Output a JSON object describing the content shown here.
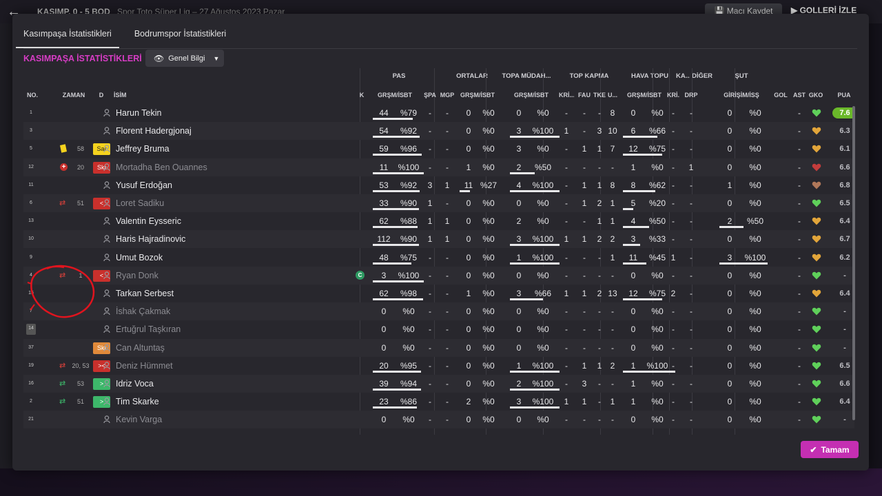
{
  "header": {
    "match_title": "KASIMP. 0 - 5 BOD",
    "match_sub": "Spor Toto Süper Lig – 27 Ağustos 2023 Pazar",
    "save_label": "Maçı Kaydet",
    "goals_label": "GOLLERİ İZLE"
  },
  "tabs": [
    {
      "label": "Kasımpaşa İstatistikleri",
      "active": true
    },
    {
      "label": "Bodrumspor İstatistikleri",
      "active": false
    }
  ],
  "section_title": "KASIMPAŞA İSTATİSTİKLERİ",
  "view_dropdown": "Genel Bilgi",
  "group_headers": [
    "PAS",
    "ORTALAR",
    "TOPA MÜDAH...",
    "TOP KAPMA",
    "HAVA TOPU",
    "KA...",
    "DİĞER",
    "ŞUT"
  ],
  "columns": [
    "NO.",
    "ZAMAN",
    "D",
    "İSİM",
    "K",
    "GRŞM/İSBT",
    "ŞPA",
    "MGP",
    "GRŞM/İSBT",
    "GRŞM/İSBT",
    "KRİ...",
    "FAU",
    "TKE",
    "U...",
    "GRŞM/İSBT",
    "KRİ...",
    "DRP",
    "GİRİŞİM/İSŞ",
    "GOL",
    "AST",
    "GKO",
    "PUA"
  ],
  "players": [
    {
      "no": "1",
      "name": "Harun Tekin",
      "pas": [
        "44",
        "%79"
      ],
      "spa": "-",
      "mgp": "-",
      "ort": [
        "0",
        "%0"
      ],
      "tm": [
        "0",
        "%0"
      ],
      "kri": "-",
      "fau": "-",
      "tke": "-",
      "u": "8",
      "hava": [
        "0",
        "%0"
      ],
      "ka": "-",
      "drp": "-",
      "sut": [
        "0",
        "%0"
      ],
      "gol": "",
      "ast": "-",
      "rating": "7.6",
      "best": true,
      "heart": "#5fd05a",
      "pas_fill": 0.79,
      "tm_fill": 0,
      "hava_fill": 0,
      "sut_fill": 0
    },
    {
      "no": "3",
      "name": "Florent Hadergjonaj",
      "pas": [
        "54",
        "%92"
      ],
      "spa": "-",
      "mgp": "-",
      "ort": [
        "0",
        "%0"
      ],
      "tm": [
        "3",
        "%100"
      ],
      "kri": "1",
      "fau": "-",
      "tke": "3",
      "u": "10",
      "hava": [
        "6",
        "%66"
      ],
      "ka": "-",
      "drp": "-",
      "sut": [
        "0",
        "%0"
      ],
      "gol": "",
      "ast": "-",
      "rating": "6.3",
      "heart": "#e2a53a",
      "pas_fill": 0.92,
      "tm_fill": 1,
      "hava_fill": 0.66,
      "sut_fill": 0
    },
    {
      "no": "5",
      "time": "58",
      "card": "yellow",
      "badge": "Sar",
      "name": "Jeffrey Bruma",
      "pas": [
        "59",
        "%96"
      ],
      "spa": "-",
      "mgp": "-",
      "ort": [
        "0",
        "%0"
      ],
      "tm": [
        "3",
        "%0"
      ],
      "kri": "-",
      "fau": "1",
      "tke": "1",
      "u": "7",
      "hava": [
        "12",
        "%75"
      ],
      "ka": "-",
      "drp": "-",
      "sut": [
        "0",
        "%0"
      ],
      "gol": "",
      "ast": "-",
      "rating": "6.1",
      "heart": "#e2a53a",
      "pas_fill": 0.96,
      "tm_fill": 0,
      "hava_fill": 0.75,
      "sut_fill": 0
    },
    {
      "no": "12",
      "time": "20",
      "injury": true,
      "badge": "Skt",
      "name": "Mortadha Ben Ouannes",
      "dim": true,
      "pas": [
        "11",
        "%100"
      ],
      "spa": "-",
      "mgp": "-",
      "ort": [
        "1",
        "%0"
      ],
      "tm": [
        "2",
        "%50"
      ],
      "kri": "-",
      "fau": "-",
      "tke": "-",
      "u": "-",
      "hava": [
        "1",
        "%0"
      ],
      "ka": "-",
      "drp": "1",
      "sut": [
        "0",
        "%0"
      ],
      "gol": "",
      "ast": "-",
      "rating": "6.6",
      "heart": "#c43c3c",
      "pas_fill": 1,
      "tm_fill": 0.5,
      "hava_fill": 0,
      "sut_fill": 0
    },
    {
      "no": "11",
      "name": "Yusuf Erdoğan",
      "pas": [
        "53",
        "%92"
      ],
      "spa": "3",
      "mgp": "1",
      "ort": [
        "11",
        "%27"
      ],
      "tm": [
        "4",
        "%100"
      ],
      "kri": "-",
      "fau": "1",
      "tke": "1",
      "u": "8",
      "hava": [
        "8",
        "%62"
      ],
      "ka": "-",
      "drp": "-",
      "sut": [
        "1",
        "%0"
      ],
      "gol": "",
      "ast": "-",
      "rating": "6.8",
      "heart": "#b0785a",
      "pas_fill": 0.92,
      "ort_fill": 0.27,
      "tm_fill": 1,
      "hava_fill": 0.62,
      "sut_fill": 0
    },
    {
      "no": "6",
      "time": "51",
      "sub": "out",
      "badge": "<",
      "name": "Loret Sadiku",
      "dim": true,
      "pas": [
        "33",
        "%90"
      ],
      "spa": "1",
      "mgp": "-",
      "ort": [
        "0",
        "%0"
      ],
      "tm": [
        "0",
        "%0"
      ],
      "kri": "-",
      "fau": "1",
      "tke": "2",
      "u": "1",
      "hava": [
        "5",
        "%20"
      ],
      "ka": "-",
      "drp": "-",
      "sut": [
        "0",
        "%0"
      ],
      "gol": "",
      "ast": "-",
      "rating": "6.5",
      "heart": "#5fd05a",
      "pas_fill": 0.9,
      "tm_fill": 0,
      "hava_fill": 0.2,
      "sut_fill": 0
    },
    {
      "no": "13",
      "name": "Valentin Eysseric",
      "pas": [
        "62",
        "%88"
      ],
      "spa": "1",
      "mgp": "1",
      "ort": [
        "0",
        "%0"
      ],
      "tm": [
        "2",
        "%0"
      ],
      "kri": "-",
      "fau": "-",
      "tke": "1",
      "u": "1",
      "hava": [
        "4",
        "%50"
      ],
      "ka": "-",
      "drp": "-",
      "sut": [
        "2",
        "%50"
      ],
      "gol": "",
      "ast": "-",
      "rating": "6.4",
      "heart": "#e2a53a",
      "pas_fill": 0.88,
      "tm_fill": 0,
      "hava_fill": 0.5,
      "sut_fill": 0.5
    },
    {
      "no": "10",
      "name": "Haris Hajradinovic",
      "pas": [
        "112",
        "%90"
      ],
      "spa": "1",
      "mgp": "1",
      "ort": [
        "0",
        "%0"
      ],
      "tm": [
        "3",
        "%100"
      ],
      "kri": "1",
      "fau": "1",
      "tke": "2",
      "u": "2",
      "hava": [
        "3",
        "%33"
      ],
      "ka": "-",
      "drp": "-",
      "sut": [
        "0",
        "%0"
      ],
      "gol": "",
      "ast": "-",
      "rating": "6.7",
      "heart": "#e2a53a",
      "pas_fill": 0.9,
      "tm_fill": 1,
      "hava_fill": 0.33,
      "sut_fill": 0
    },
    {
      "no": "9",
      "name": "Umut Bozok",
      "pas": [
        "48",
        "%75"
      ],
      "spa": "-",
      "mgp": "-",
      "ort": [
        "0",
        "%0"
      ],
      "tm": [
        "1",
        "%100"
      ],
      "kri": "-",
      "fau": "-",
      "tke": "-",
      "u": "1",
      "hava": [
        "11",
        "%45"
      ],
      "ka": "1",
      "drp": "-",
      "sut": [
        "3",
        "%100"
      ],
      "gol": "",
      "ast": "-",
      "rating": "6.2",
      "heart": "#e2a53a",
      "pas_fill": 0.75,
      "tm_fill": 1,
      "hava_fill": 0.45,
      "sut_fill": 1
    },
    {
      "no": "4",
      "time": "1",
      "sub": "out",
      "badge": "<",
      "name": "Ryan Donk",
      "dim": true,
      "captain": true,
      "pas": [
        "3",
        "%100"
      ],
      "spa": "-",
      "mgp": "-",
      "ort": [
        "0",
        "%0"
      ],
      "tm": [
        "0",
        "%0"
      ],
      "kri": "-",
      "fau": "-",
      "tke": "-",
      "u": "-",
      "hava": [
        "0",
        "%0"
      ],
      "ka": "-",
      "drp": "-",
      "sut": [
        "0",
        "%0"
      ],
      "gol": "",
      "ast": "-",
      "rating": "-",
      "heart": "#5fd05a",
      "pas_fill": 1,
      "tm_fill": 0,
      "hava_fill": 0,
      "sut_fill": 0
    },
    {
      "no": "15",
      "name": "Tarkan Serbest",
      "pas": [
        "62",
        "%98"
      ],
      "spa": "-",
      "mgp": "-",
      "ort": [
        "1",
        "%0"
      ],
      "tm": [
        "3",
        "%66"
      ],
      "kri": "1",
      "fau": "1",
      "tke": "2",
      "u": "13",
      "hava": [
        "12",
        "%75"
      ],
      "ka": "2",
      "drp": "-",
      "sut": [
        "0",
        "%0"
      ],
      "gol": "",
      "ast": "-",
      "rating": "6.4",
      "heart": "#e2a53a",
      "pas_fill": 0.98,
      "tm_fill": 0.66,
      "hava_fill": 0.75,
      "sut_fill": 0
    },
    {
      "no": "7",
      "name": "İshak Çakmak",
      "dim": true,
      "pas": [
        "0",
        "%0"
      ],
      "spa": "-",
      "mgp": "-",
      "ort": [
        "0",
        "%0"
      ],
      "tm": [
        "0",
        "%0"
      ],
      "kri": "-",
      "fau": "-",
      "tke": "-",
      "u": "-",
      "hava": [
        "0",
        "%0"
      ],
      "ka": "-",
      "drp": "-",
      "sut": [
        "0",
        "%0"
      ],
      "gol": "",
      "ast": "-",
      "rating": "-",
      "heart": "#5fd05a"
    },
    {
      "no": "14",
      "box": true,
      "name": "Ertuğrul Taşkıran",
      "dim": true,
      "pas": [
        "0",
        "%0"
      ],
      "spa": "-",
      "mgp": "-",
      "ort": [
        "0",
        "%0"
      ],
      "tm": [
        "0",
        "%0"
      ],
      "kri": "-",
      "fau": "-",
      "tke": "-",
      "u": "-",
      "hava": [
        "0",
        "%0"
      ],
      "ka": "-",
      "drp": "-",
      "sut": [
        "0",
        "%0"
      ],
      "gol": "",
      "ast": "-",
      "rating": "-",
      "heart": "#5fd05a"
    },
    {
      "no": "37",
      "badge": "Skt",
      "badge_color": "orange",
      "name": "Can Altuntaş",
      "dim": true,
      "pas": [
        "0",
        "%0"
      ],
      "spa": "-",
      "mgp": "-",
      "ort": [
        "0",
        "%0"
      ],
      "tm": [
        "0",
        "%0"
      ],
      "kri": "-",
      "fau": "-",
      "tke": "-",
      "u": "-",
      "hava": [
        "0",
        "%0"
      ],
      "ka": "-",
      "drp": "-",
      "sut": [
        "0",
        "%0"
      ],
      "gol": "",
      "ast": "-",
      "rating": "-",
      "heart": "#5fd05a"
    },
    {
      "no": "19",
      "time": "20, 53",
      "sub": "both",
      "badge": "><",
      "name": "Deniz Hümmet",
      "dim": true,
      "pas": [
        "20",
        "%95"
      ],
      "spa": "-",
      "mgp": "-",
      "ort": [
        "0",
        "%0"
      ],
      "tm": [
        "1",
        "%100"
      ],
      "kri": "-",
      "fau": "1",
      "tke": "1",
      "u": "2",
      "hava": [
        "1",
        "%100"
      ],
      "ka": "-",
      "drp": "-",
      "sut": [
        "0",
        "%0"
      ],
      "gol": "",
      "ast": "-",
      "rating": "6.5",
      "heart": "#5fd05a",
      "pas_fill": 0.95,
      "tm_fill": 1,
      "hava_fill": 1,
      "sut_fill": 0
    },
    {
      "no": "16",
      "time": "53",
      "sub": "in",
      "badge": ">",
      "name": "Idriz Voca",
      "pas": [
        "39",
        "%94"
      ],
      "spa": "-",
      "mgp": "-",
      "ort": [
        "0",
        "%0"
      ],
      "tm": [
        "2",
        "%100"
      ],
      "kri": "-",
      "fau": "3",
      "tke": "-",
      "u": "-",
      "hava": [
        "1",
        "%0"
      ],
      "ka": "-",
      "drp": "-",
      "sut": [
        "0",
        "%0"
      ],
      "gol": "",
      "ast": "-",
      "rating": "6.6",
      "heart": "#5fd05a",
      "pas_fill": 0.94,
      "tm_fill": 1,
      "hava_fill": 0,
      "sut_fill": 0
    },
    {
      "no": "2",
      "time": "51",
      "sub": "in",
      "badge": ">",
      "name": "Tim Skarke",
      "pas": [
        "23",
        "%86"
      ],
      "spa": "-",
      "mgp": "-",
      "ort": [
        "2",
        "%0"
      ],
      "tm": [
        "3",
        "%100"
      ],
      "kri": "1",
      "fau": "1",
      "tke": "-",
      "u": "1",
      "hava": [
        "1",
        "%0"
      ],
      "ka": "-",
      "drp": "-",
      "sut": [
        "0",
        "%0"
      ],
      "gol": "",
      "ast": "-",
      "rating": "6.4",
      "heart": "#5fd05a",
      "pas_fill": 0.86,
      "tm_fill": 1,
      "hava_fill": 0,
      "sut_fill": 0
    },
    {
      "no": "21",
      "name": "Kevin Varga",
      "dim": true,
      "pas": [
        "0",
        "%0"
      ],
      "spa": "-",
      "mgp": "-",
      "ort": [
        "0",
        "%0"
      ],
      "tm": [
        "0",
        "%0"
      ],
      "kri": "-",
      "fau": "-",
      "tke": "-",
      "u": "-",
      "hava": [
        "0",
        "%0"
      ],
      "ka": "-",
      "drp": "-",
      "sut": [
        "0",
        "%0"
      ],
      "gol": "",
      "ast": "-",
      "rating": "-",
      "heart": "#5fd05a"
    }
  ],
  "ok_label": "Tamam",
  "colors": {
    "accent": "#d63cc4",
    "button": "#c42fb2",
    "rating_best": "#6ab82a",
    "card_yellow": "#f5d21e",
    "card_red": "#c9302c",
    "sub_in": "#3db76a",
    "sub_out": "#d9403a"
  }
}
